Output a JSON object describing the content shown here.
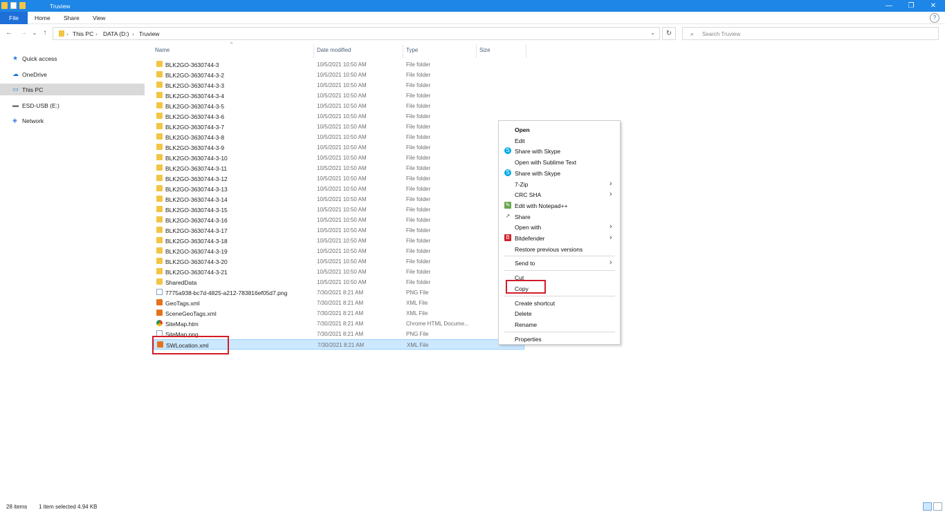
{
  "window": {
    "title": "Truview",
    "controls": {
      "minimize": "—",
      "maximize": "❐",
      "close": "✕"
    },
    "help": "?"
  },
  "ribbon": {
    "tabs": [
      "File",
      "Home",
      "Share",
      "View"
    ]
  },
  "nav": {
    "back": "←",
    "forward": "→",
    "recent": "⌄",
    "up": "↑"
  },
  "address": {
    "crumbs": [
      "This PC",
      "DATA (D:)",
      "Truview"
    ],
    "separator": "›",
    "dropdown": "⌄",
    "refresh": "↻"
  },
  "search": {
    "icon": "⌕",
    "placeholder": "Search Truview"
  },
  "sidebar": {
    "items": [
      {
        "label": "Quick access",
        "icon": "star-icon",
        "glyph": "★",
        "color": "#2d7bd4"
      },
      {
        "label": "OneDrive",
        "icon": "cloud-icon",
        "glyph": "☁",
        "color": "#1e6fd9"
      },
      {
        "label": "This PC",
        "icon": "computer-icon",
        "glyph": "▭",
        "color": "#3a7bd5",
        "selected": true
      },
      {
        "label": "ESD-USB (E:)",
        "icon": "usb-drive-icon",
        "glyph": "▬",
        "color": "#777"
      },
      {
        "label": "Network",
        "icon": "network-icon",
        "glyph": "◈",
        "color": "#3a7bd5"
      }
    ]
  },
  "columns": {
    "name": "Name",
    "date": "Date modified",
    "type": "Type",
    "size": "Size",
    "sort": "^"
  },
  "files": [
    {
      "name": "BLK2GO-3630744-3",
      "date": "10/5/2021 10:50 AM",
      "type": "File folder",
      "size": "",
      "icon": "folder"
    },
    {
      "name": "BLK2GO-3630744-3-2",
      "date": "10/5/2021 10:50 AM",
      "type": "File folder",
      "size": "",
      "icon": "folder"
    },
    {
      "name": "BLK2GO-3630744-3-3",
      "date": "10/5/2021 10:50 AM",
      "type": "File folder",
      "size": "",
      "icon": "folder"
    },
    {
      "name": "BLK2GO-3630744-3-4",
      "date": "10/5/2021 10:50 AM",
      "type": "File folder",
      "size": "",
      "icon": "folder"
    },
    {
      "name": "BLK2GO-3630744-3-5",
      "date": "10/5/2021 10:50 AM",
      "type": "File folder",
      "size": "",
      "icon": "folder"
    },
    {
      "name": "BLK2GO-3630744-3-6",
      "date": "10/5/2021 10:50 AM",
      "type": "File folder",
      "size": "",
      "icon": "folder"
    },
    {
      "name": "BLK2GO-3630744-3-7",
      "date": "10/5/2021 10:50 AM",
      "type": "File folder",
      "size": "",
      "icon": "folder"
    },
    {
      "name": "BLK2GO-3630744-3-8",
      "date": "10/5/2021 10:50 AM",
      "type": "File folder",
      "size": "",
      "icon": "folder"
    },
    {
      "name": "BLK2GO-3630744-3-9",
      "date": "10/5/2021 10:50 AM",
      "type": "File folder",
      "size": "",
      "icon": "folder"
    },
    {
      "name": "BLK2GO-3630744-3-10",
      "date": "10/5/2021 10:50 AM",
      "type": "File folder",
      "size": "",
      "icon": "folder"
    },
    {
      "name": "BLK2GO-3630744-3-11",
      "date": "10/5/2021 10:50 AM",
      "type": "File folder",
      "size": "",
      "icon": "folder"
    },
    {
      "name": "BLK2GO-3630744-3-12",
      "date": "10/5/2021 10:50 AM",
      "type": "File folder",
      "size": "",
      "icon": "folder"
    },
    {
      "name": "BLK2GO-3630744-3-13",
      "date": "10/5/2021 10:50 AM",
      "type": "File folder",
      "size": "",
      "icon": "folder"
    },
    {
      "name": "BLK2GO-3630744-3-14",
      "date": "10/5/2021 10:50 AM",
      "type": "File folder",
      "size": "",
      "icon": "folder"
    },
    {
      "name": "BLK2GO-3630744-3-15",
      "date": "10/5/2021 10:50 AM",
      "type": "File folder",
      "size": "",
      "icon": "folder"
    },
    {
      "name": "BLK2GO-3630744-3-16",
      "date": "10/5/2021 10:50 AM",
      "type": "File folder",
      "size": "",
      "icon": "folder"
    },
    {
      "name": "BLK2GO-3630744-3-17",
      "date": "10/5/2021 10:50 AM",
      "type": "File folder",
      "size": "",
      "icon": "folder"
    },
    {
      "name": "BLK2GO-3630744-3-18",
      "date": "10/5/2021 10:50 AM",
      "type": "File folder",
      "size": "",
      "icon": "folder"
    },
    {
      "name": "BLK2GO-3630744-3-19",
      "date": "10/5/2021 10:50 AM",
      "type": "File folder",
      "size": "",
      "icon": "folder"
    },
    {
      "name": "BLK2GO-3630744-3-20",
      "date": "10/5/2021 10:50 AM",
      "type": "File folder",
      "size": "",
      "icon": "folder"
    },
    {
      "name": "BLK2GO-3630744-3-21",
      "date": "10/5/2021 10:50 AM",
      "type": "File folder",
      "size": "",
      "icon": "folder"
    },
    {
      "name": "SharedData",
      "date": "10/5/2021 10:50 AM",
      "type": "File folder",
      "size": "",
      "icon": "folder"
    },
    {
      "name": "7775a938-bc7d-4825-a212-783816ef05d7.png",
      "date": "7/30/2021 8:21 AM",
      "type": "PNG File",
      "size": "",
      "icon": "png"
    },
    {
      "name": "GeoTags.xml",
      "date": "7/30/2021 8:21 AM",
      "type": "XML File",
      "size": "",
      "icon": "xml"
    },
    {
      "name": "SceneGeoTags.xml",
      "date": "7/30/2021 8:21 AM",
      "type": "XML File",
      "size": "",
      "icon": "xml"
    },
    {
      "name": "SiteMap.htm",
      "date": "7/30/2021 8:21 AM",
      "type": "Chrome HTML Docume...",
      "size": "",
      "icon": "htm"
    },
    {
      "name": "SiteMap.png",
      "date": "7/30/2021 8:21 AM",
      "type": "PNG File",
      "size": "",
      "icon": "png"
    },
    {
      "name": "SWLocation.xml",
      "date": "7/30/2021 8:21 AM",
      "type": "XML File",
      "size": "",
      "icon": "xml",
      "selected": true
    }
  ],
  "context_menu": {
    "items": [
      {
        "label": "Open",
        "bold": true
      },
      {
        "label": "Edit"
      },
      {
        "label": "Share with Skype",
        "icon": "skype-icon",
        "glyph": "S",
        "color": "#00a8e6"
      },
      {
        "label": "Open with Sublime Text"
      },
      {
        "label": "Share with Skype",
        "icon": "skype-icon",
        "glyph": "S",
        "color": "#00a8e6"
      },
      {
        "label": "7-Zip",
        "submenu": true
      },
      {
        "label": "CRC SHA",
        "submenu": true
      },
      {
        "label": "Edit with Notepad++",
        "icon": "notepad-plus-plus-icon",
        "glyph": "✎",
        "color": "#6aa84f"
      },
      {
        "label": "Share",
        "icon": "share-icon",
        "glyph": "↗",
        "color": "#555"
      },
      {
        "label": "Open with",
        "submenu": true
      },
      {
        "label": "Bitdefender",
        "icon": "bitdefender-icon",
        "glyph": "B",
        "color": "#d11f2a",
        "submenu": true
      },
      {
        "label": "Restore previous versions"
      },
      {
        "separator": true
      },
      {
        "label": "Send to",
        "submenu": true
      },
      {
        "separator": true
      },
      {
        "label": "Cut"
      },
      {
        "label": "Copy",
        "highlighted": true
      },
      {
        "separator": true
      },
      {
        "label": "Create shortcut"
      },
      {
        "label": "Delete"
      },
      {
        "label": "Rename"
      },
      {
        "separator": true
      },
      {
        "label": "Properties"
      }
    ],
    "submenu_arrow": "›"
  },
  "status": {
    "count": "28 items",
    "selection": "1 item selected  4.94 KB"
  },
  "colors": {
    "accent": "#1e86e6",
    "selection": "#cce8ff",
    "annotation": "#d31b2a",
    "folder": "#f3c545"
  }
}
